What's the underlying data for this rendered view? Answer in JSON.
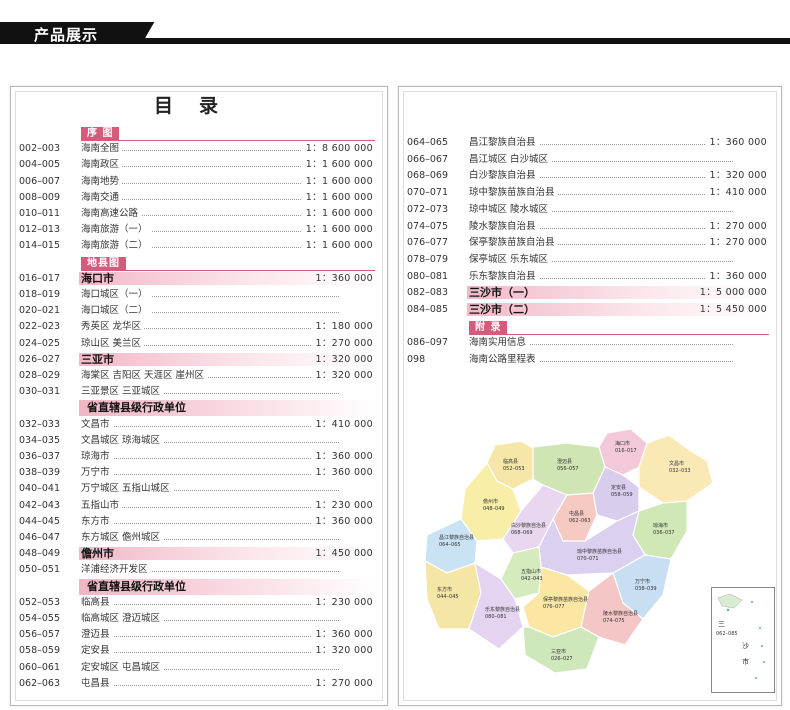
{
  "banner": {
    "title": "产品展示"
  },
  "toc": {
    "title": "目录",
    "left": [
      {
        "type": "sec",
        "label": "序  图"
      },
      {
        "type": "row",
        "pages": "002–003",
        "name": "海南全图",
        "scale": "1：8 600 000"
      },
      {
        "type": "row",
        "pages": "004–005",
        "name": "海南政区",
        "scale": "1：1 600 000"
      },
      {
        "type": "row",
        "pages": "006–007",
        "name": "海南地势",
        "scale": "1：1 600 000"
      },
      {
        "type": "row",
        "pages": "008–009",
        "name": "海南交通",
        "scale": "1：1 600 000"
      },
      {
        "type": "row",
        "pages": "010–011",
        "name": "海南高速公路",
        "scale": "1：1 600 000"
      },
      {
        "type": "row",
        "pages": "012–013",
        "name": "海南旅游（一）",
        "scale": "1：1 600 000"
      },
      {
        "type": "row",
        "pages": "014–015",
        "name": "海南旅游（二）",
        "scale": "1：1 600 000"
      },
      {
        "type": "sec",
        "label": "地县图"
      },
      {
        "type": "hl",
        "pages": "016–017",
        "name": "海口市",
        "scale": "1：360 000"
      },
      {
        "type": "row",
        "pages": "018–019",
        "name": "海口城区（一）",
        "scale": ""
      },
      {
        "type": "row",
        "pages": "020–021",
        "name": "海口城区（二）",
        "scale": ""
      },
      {
        "type": "row",
        "pages": "022–023",
        "name": "秀英区  龙华区",
        "scale": "1：180 000"
      },
      {
        "type": "row",
        "pages": "024–025",
        "name": "琼山区  美兰区",
        "scale": "1：270 000"
      },
      {
        "type": "hl",
        "pages": "026–027",
        "name": "三亚市",
        "scale": "1：320 000"
      },
      {
        "type": "row",
        "pages": "028–029",
        "name": "海棠区  吉阳区  天涯区  崖州区",
        "scale": "1：320 000"
      },
      {
        "type": "row",
        "pages": "030–031",
        "name": "三亚景区  三亚城区",
        "scale": ""
      },
      {
        "type": "grp",
        "label": "省直辖县级行政单位"
      },
      {
        "type": "row",
        "pages": "032–033",
        "name": "文昌市",
        "scale": "1：410 000"
      },
      {
        "type": "row",
        "pages": "034–035",
        "name": "文昌城区  琼海城区",
        "scale": ""
      },
      {
        "type": "row",
        "pages": "036–037",
        "name": "琼海市",
        "scale": "1：360 000"
      },
      {
        "type": "row",
        "pages": "038–039",
        "name": "万宁市",
        "scale": "1：360 000"
      },
      {
        "type": "row",
        "pages": "040–041",
        "name": "万宁城区  五指山城区",
        "scale": ""
      },
      {
        "type": "row",
        "pages": "042–043",
        "name": "五指山市",
        "scale": "1：230 000"
      },
      {
        "type": "row",
        "pages": "044–045",
        "name": "东方市",
        "scale": "1：360 000"
      },
      {
        "type": "row",
        "pages": "046–047",
        "name": "东方城区  儋州城区",
        "scale": ""
      },
      {
        "type": "hl",
        "pages": "048–049",
        "name": "儋州市",
        "scale": "1：450 000"
      },
      {
        "type": "row",
        "pages": "050–051",
        "name": "洋浦经济开发区",
        "scale": ""
      },
      {
        "type": "grp",
        "label": "省直辖县级行政单位"
      },
      {
        "type": "row",
        "pages": "052–053",
        "name": "临高县",
        "scale": "1：230 000"
      },
      {
        "type": "row",
        "pages": "054–055",
        "name": "临高城区  澄迈城区",
        "scale": ""
      },
      {
        "type": "row",
        "pages": "056–057",
        "name": "澄迈县",
        "scale": "1：360 000"
      },
      {
        "type": "row",
        "pages": "058–059",
        "name": "定安县",
        "scale": "1：320 000"
      },
      {
        "type": "row",
        "pages": "060–061",
        "name": "定安城区  屯昌城区",
        "scale": ""
      },
      {
        "type": "row",
        "pages": "062–063",
        "name": "屯昌县",
        "scale": "1：270 000"
      }
    ],
    "right": [
      {
        "type": "row",
        "pages": "064–065",
        "name": "昌江黎族自治县",
        "scale": "1：360 000"
      },
      {
        "type": "row",
        "pages": "066–067",
        "name": "昌江城区  白沙城区",
        "scale": ""
      },
      {
        "type": "row",
        "pages": "068–069",
        "name": "白沙黎族自治县",
        "scale": "1：320 000"
      },
      {
        "type": "row",
        "pages": "070–071",
        "name": "琼中黎族苗族自治县",
        "scale": "1：410 000"
      },
      {
        "type": "row",
        "pages": "072–073",
        "name": "琼中城区  陵水城区",
        "scale": ""
      },
      {
        "type": "row",
        "pages": "074–075",
        "name": "陵水黎族自治县",
        "scale": "1：270 000"
      },
      {
        "type": "row",
        "pages": "076–077",
        "name": "保亭黎族苗族自治县",
        "scale": "1：270 000"
      },
      {
        "type": "row",
        "pages": "078–079",
        "name": "保亭城区  乐东城区",
        "scale": ""
      },
      {
        "type": "row",
        "pages": "080–081",
        "name": "乐东黎族自治县",
        "scale": "1：360 000"
      },
      {
        "type": "hl",
        "pages": "082–083",
        "name": "三沙市（一）",
        "scale": "1：5 000 000"
      },
      {
        "type": "hl",
        "pages": "084–085",
        "name": "三沙市（二）",
        "scale": "1：5 450 000"
      },
      {
        "type": "sec",
        "label": "附  录"
      },
      {
        "type": "row",
        "pages": "086–097",
        "name": "海南实用信息",
        "scale": ""
      },
      {
        "type": "row",
        "pages": "098",
        "name": "海南公路里程表",
        "scale": ""
      }
    ]
  },
  "map": {
    "regions": [
      {
        "name": "临高县",
        "code": "052–053",
        "color": "#f6e7a8"
      },
      {
        "name": "海口市",
        "code": "016–017",
        "color": "#f3c8d8"
      },
      {
        "name": "文昌市",
        "code": "032–033",
        "color": "#fbe9b5"
      },
      {
        "name": "澄迈县",
        "code": "056–057",
        "color": "#cfe6b4"
      },
      {
        "name": "儋州市",
        "code": "048–049",
        "color": "#f9eea8"
      },
      {
        "name": "定安县",
        "code": "058–059",
        "color": "#d9cdee"
      },
      {
        "name": "昌江黎族自治县",
        "code": "064–065",
        "color": "#c9e2f4"
      },
      {
        "name": "屯昌县",
        "code": "062–063",
        "color": "#f7c9c3"
      },
      {
        "name": "白沙黎族自治县",
        "code": "068–069",
        "color": "#e9d7ef"
      },
      {
        "name": "琼海市",
        "code": "036–037",
        "color": "#cfe8b6"
      },
      {
        "name": "东方市",
        "code": "044–045",
        "color": "#f5e6a6"
      },
      {
        "name": "琼中黎族苗族自治县",
        "code": "070–071",
        "color": "#dcd0f0"
      },
      {
        "name": "五指山市",
        "code": "042–043",
        "color": "#d6ebbd"
      },
      {
        "name": "万宁市",
        "code": "038–039",
        "color": "#c7def3"
      },
      {
        "name": "乐东黎族自治县",
        "code": "080–081",
        "color": "#e4d3f1"
      },
      {
        "name": "保亭黎族苗族自治县",
        "code": "076–077",
        "color": "#fbe7a3"
      },
      {
        "name": "陵水黎族自治县",
        "code": "074–075",
        "color": "#f5c6c6"
      },
      {
        "name": "三亚市",
        "code": "026–027",
        "color": "#cfe8bb"
      }
    ],
    "inset": {
      "label1": "三",
      "code": "062–085",
      "label2": "沙",
      "label3": "市"
    }
  }
}
